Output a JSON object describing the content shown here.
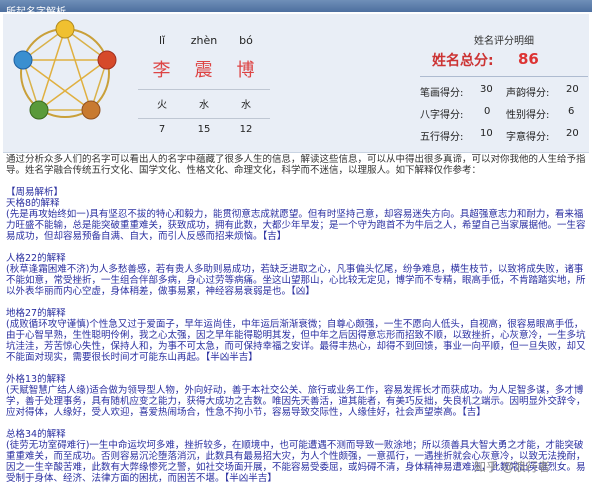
{
  "window": {
    "title": "所起名字解析"
  },
  "name": {
    "pinyin": [
      "lǐ",
      "zhèn",
      "bó"
    ],
    "chars": [
      "李",
      "震",
      "博"
    ],
    "wuxing": [
      "火",
      "水",
      "水"
    ],
    "strokes": [
      "7",
      "15",
      "12"
    ]
  },
  "scores": {
    "header": "姓名评分明细",
    "total_label": "姓名总分:",
    "total_value": "86",
    "rows": [
      {
        "l1": "笔画得分:",
        "v1": "30",
        "l2": "声韵得分:",
        "v2": "20"
      },
      {
        "l1": "八字得分:",
        "v1": "0",
        "l2": "性别得分:",
        "v2": "6"
      },
      {
        "l1": "五行得分:",
        "v1": "10",
        "l2": "字意得分:",
        "v2": "20"
      }
    ]
  },
  "content": {
    "intro": "通过分析众多人们的名字可以看出人的名字中蕴藏了很多人生的信息，解读这些信息，可以从中得出很多真谛，可以对你我他的人生给予指导。姓名学融合传统五行文化、国学文化、性格文化、命理文化，科学而不迷信，以理服人。如下解释仅作参考：",
    "sections": [
      {
        "title": "【周易解析】",
        "header": "天格8的解释",
        "body": "(先是再攻始终如一)具有坚忍不拔的特心和毅力，能贯彻意志成就愿望。但有时坚持己意，却容易迷失方向。具超强意志力和耐力，看来福力旺盛不能输，总是能突破重重难关，获致成功，拥有此数，大都少年早发；是一个守为跑首不为牛后之人，希望自己当家展据他。一生容易成功，但却容易预备自满、自大，而引人反感而招来烦恼。【吉】"
      },
      {
        "title": "",
        "header": "人格22的解释",
        "body": "(秋草逢霜困难不济)为人多愁善感，若有贵人多助则易成功，若缺乏进取之心，凡事偏头忆尾，纷争难息，横生枝节，以致将成失败，诸事不能如意，常受挫折，一生组合伴部多病，身心过劳等病痛。坐这山望那山，心比较无定见，博学而不专精，眼高手低，不肯踏踏实地，所以外表华丽而内心空虚，身体稍差，做事易累，神经容易衰弱是也。【凶】"
      },
      {
        "title": "",
        "header": "地格27的解释",
        "body": "(成败循环攻守谨慎)个性急又过于爱面子，早年运尚佳，中年运后渐渐衰微；自尊心颇强，一生不愿向人低头，自视高，很容易眼高手低，由于心智早熟，生性聪明伶俐，我之心太强，因之早年能得聪明其发，但中年之后因得意忘形而招致不顺，以致挫折，心灰意冷，一生多坑坑洼洼，芳苦惊心失性，保持人和，为事不可太急，而可保持幸福之安详。最得丰热心，却得不到回馈，事业一向平顺，但一旦失败，却又不能面对现实，需要很长时间才可能东山再起。【半凶半吉】"
      },
      {
        "title": "",
        "header": "外格13的解释",
        "body": "(天赋智慧广结人缘)适合做为领导型人物，外向好动，善于本社交公关、旅行或业务工作，容易发挥长才而获成功。为人足智多谋，多才博学，善于处理事务，具有随机应变之能力，获得大成功之吉数。唯因先天善活，道其能者，有美巧反拙，失良机之端示。因明显外交辞令，应对得体，人缘好，受人欢迎，喜爱热闹场合，性急不拘小节，容易导致交际性，人缘佳好，社会声望崇高。【吉】"
      },
      {
        "title": "",
        "header": "总格34的解释",
        "body": "(徒劳无功室碍难行)一生中命运坎坷多难，挫折较多，在顺境中，也可能遭遇不测而导致一败涂地；所以须善具大智大勇之才能，才能突破重重难关，而至成功。否则容易沉沦堕落消沉，此数具有最易招大灾，为人个性颇强，一意孤行，一遇挫折就会心灰意冷，以致无法挽耐，因之一生辛酸苦难，此数有大弊缘惨死之警，如社交场面开展，不能容易受委屈，或妈碍不清，身体精神易遭难迷，此数常出英雄烈女。易受制于身体、经济、法律方面的困扰，而困苦不堪。【半凶半吉】"
      }
    ]
  },
  "watermark": "知乎 @浪行者"
}
